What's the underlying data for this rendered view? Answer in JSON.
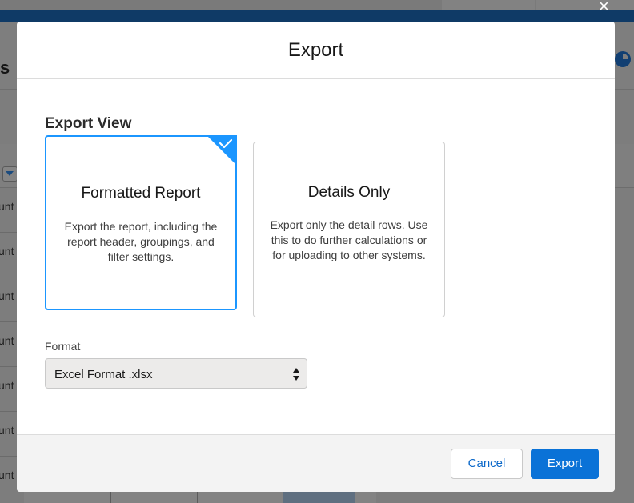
{
  "background": {
    "title_fragment": "s R",
    "row_text": "unt"
  },
  "modal": {
    "title": "Export",
    "close_label": "×",
    "section_title": "Export View",
    "options": [
      {
        "title": "Formatted Report",
        "description": "Export the report, including the report header, groupings, and filter settings.",
        "selected": true
      },
      {
        "title": "Details Only",
        "description": "Export only the detail rows. Use this to do further calculations or for uploading to other systems.",
        "selected": false
      }
    ],
    "format": {
      "label": "Format",
      "selected_value": "Excel Format .xlsx"
    },
    "footer": {
      "cancel_label": "Cancel",
      "export_label": "Export"
    }
  },
  "colors": {
    "accent": "#1b96ff",
    "brand_button": "#0a72d7",
    "link": "#0b68c9"
  },
  "icons": {
    "selected_indicator": "checkmark-icon",
    "select_arrows": "sort-arrows-icon",
    "close": "close-icon"
  }
}
